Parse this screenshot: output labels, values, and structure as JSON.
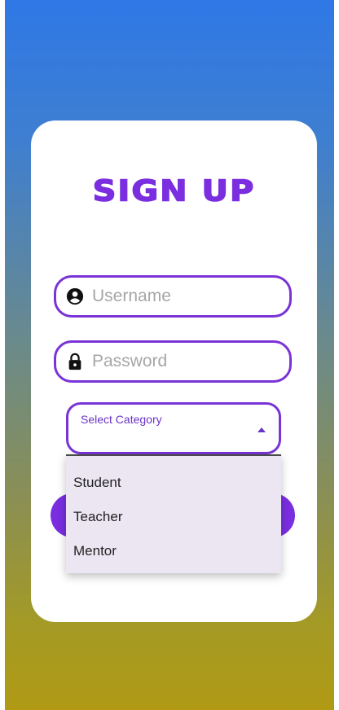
{
  "form": {
    "title": "SIGN UP",
    "username_placeholder": "Username",
    "password_placeholder": "Password"
  },
  "category_select": {
    "label": "Select Category",
    "options": [
      "Student",
      "Teacher",
      "Mentor"
    ]
  },
  "icons": {
    "username": "account-circle-icon",
    "password": "lock-icon",
    "select_arrow": "arrow-up-icon"
  },
  "colors": {
    "accent": "#7a2ee0",
    "gradient_top": "#2f78e6",
    "gradient_bottom": "#b09a14",
    "menu_bg": "#ece6f3"
  }
}
